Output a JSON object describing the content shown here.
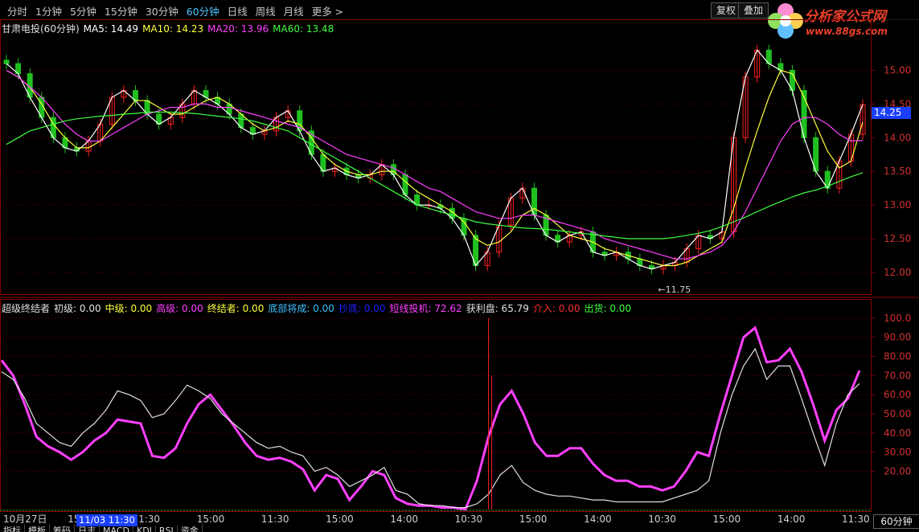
{
  "toolbar": {
    "tabs": [
      "分时",
      "1分钟",
      "5分钟",
      "15分钟",
      "30分钟",
      "60分钟",
      "日线",
      "周线",
      "月线",
      "更多 >"
    ],
    "active_tab": "60分钟",
    "fuquan_label": "复权",
    "overlay_label": "叠加"
  },
  "logo": {
    "name": "分析家公式网",
    "url": "www.88gs.com"
  },
  "stock_line": {
    "name": "甘肃电投(60分钟)",
    "ma5": "MA5: 14.49",
    "ma10": "MA10: 14.23",
    "ma20": "MA20: 13.96",
    "ma60": "MA60: 13.48"
  },
  "indicator_line": {
    "name": "超级终结者",
    "items": [
      {
        "label": "初级: 0.00",
        "color": "#e0e0e0"
      },
      {
        "label": "中级: 0.00",
        "color": "#ffff40"
      },
      {
        "label": "高级: 0.00",
        "color": "#ff40ff"
      },
      {
        "label": "终结者: 0.00",
        "color": "#ffff40"
      },
      {
        "label": "底部将成: 0.00",
        "color": "#40c0ff"
      },
      {
        "label": "抄底: 0.00",
        "color": "#2020ff"
      },
      {
        "label": "短线投机: 72.62",
        "color": "#ff40ff"
      },
      {
        "label": "获利盘: 65.79",
        "color": "#e0e0e0"
      },
      {
        "label": "介入: 0.00",
        "color": "#ff3030"
      },
      {
        "label": "出货: 0.00",
        "color": "#40ff40"
      }
    ]
  },
  "price_tag": "14.25",
  "high_label": "11.75",
  "time_cursor": "11/03 11:30",
  "period_box": "60分钟",
  "bottom_tabs": [
    "指标",
    "模板",
    "筹码",
    "日志",
    "MACD",
    "KDJ",
    "RSI",
    "资金"
  ],
  "chart_data": [
    {
      "type": "candlestick",
      "title": "甘肃电投(60分钟)",
      "ylim": [
        11.7,
        15.4
      ],
      "yticks": [
        "15.00",
        "14.50",
        "14.00",
        "13.50",
        "13.00",
        "12.50",
        "12.00"
      ],
      "ytick_values": [
        15.0,
        14.5,
        14.0,
        13.5,
        13.0,
        12.5,
        12.0
      ],
      "low_annotation": "11.75",
      "colors": {
        "up": "#ff2020",
        "down": "#20c020",
        "ma5": "#ffffff",
        "ma10": "#ffff40",
        "ma20": "#ff40ff",
        "ma60": "#40ff40"
      },
      "series": [
        {
          "name": "MA5",
          "values": [
            15.1,
            14.95,
            14.6,
            14.3,
            14.0,
            13.85,
            13.8,
            13.95,
            14.2,
            14.6,
            14.7,
            14.55,
            14.35,
            14.2,
            14.3,
            14.5,
            14.7,
            14.6,
            14.5,
            14.35,
            14.15,
            14.05,
            14.1,
            14.3,
            14.4,
            14.1,
            13.75,
            13.5,
            13.55,
            13.45,
            13.4,
            13.45,
            13.6,
            13.45,
            13.15,
            13.0,
            13.0,
            12.95,
            12.8,
            12.55,
            12.1,
            12.3,
            12.7,
            13.1,
            13.25,
            12.85,
            12.55,
            12.45,
            12.55,
            12.6,
            12.3,
            12.25,
            12.3,
            12.2,
            12.1,
            12.05,
            12.1,
            12.15,
            12.35,
            12.55,
            12.5,
            12.6,
            14.0,
            14.9,
            15.3,
            15.1,
            15.0,
            14.7,
            14.0,
            13.5,
            13.25,
            13.65,
            14.05,
            14.49
          ]
        },
        {
          "name": "MA10",
          "values": [
            15.0,
            14.9,
            14.75,
            14.5,
            14.2,
            14.0,
            13.85,
            13.85,
            13.95,
            14.15,
            14.35,
            14.55,
            14.55,
            14.45,
            14.35,
            14.35,
            14.45,
            14.55,
            14.6,
            14.5,
            14.35,
            14.2,
            14.1,
            14.15,
            14.25,
            14.2,
            14.0,
            13.75,
            13.6,
            13.5,
            13.45,
            13.45,
            13.5,
            13.5,
            13.35,
            13.2,
            13.1,
            13.0,
            12.9,
            12.75,
            12.5,
            12.4,
            12.45,
            12.6,
            12.85,
            12.95,
            12.85,
            12.7,
            12.55,
            12.5,
            12.45,
            12.35,
            12.3,
            12.25,
            12.2,
            12.15,
            12.1,
            12.1,
            12.15,
            12.25,
            12.35,
            12.45,
            12.95,
            13.55,
            14.1,
            14.6,
            15.0,
            14.95,
            14.6,
            14.2,
            13.8,
            13.55,
            13.65,
            14.23
          ]
        },
        {
          "name": "MA20",
          "values": [
            15.0,
            14.9,
            14.75,
            14.6,
            14.4,
            14.2,
            14.05,
            13.95,
            13.95,
            14.05,
            14.15,
            14.25,
            14.35,
            14.4,
            14.45,
            14.45,
            14.5,
            14.5,
            14.45,
            14.45,
            14.4,
            14.35,
            14.3,
            14.25,
            14.2,
            14.15,
            14.05,
            13.95,
            13.85,
            13.75,
            13.7,
            13.65,
            13.6,
            13.55,
            13.45,
            13.35,
            13.25,
            13.2,
            13.1,
            13.0,
            12.9,
            12.85,
            12.8,
            12.8,
            12.85,
            12.85,
            12.8,
            12.75,
            12.7,
            12.65,
            12.6,
            12.5,
            12.45,
            12.4,
            12.35,
            12.3,
            12.25,
            12.2,
            12.2,
            12.25,
            12.3,
            12.4,
            12.6,
            12.9,
            13.25,
            13.6,
            13.95,
            14.2,
            14.3,
            14.3,
            14.2,
            14.05,
            13.95,
            13.96
          ]
        },
        {
          "name": "MA60",
          "values": [
            13.9,
            14.0,
            14.1,
            14.15,
            14.2,
            14.25,
            14.28,
            14.3,
            14.32,
            14.33,
            14.35,
            14.36,
            14.38,
            14.38,
            14.38,
            14.37,
            14.36,
            14.34,
            14.32,
            14.3,
            14.28,
            14.25,
            14.2,
            14.15,
            14.1,
            14.0,
            13.9,
            13.8,
            13.7,
            13.6,
            13.5,
            13.4,
            13.3,
            13.2,
            13.1,
            13.0,
            12.95,
            12.9,
            12.85,
            12.8,
            12.75,
            12.72,
            12.7,
            12.68,
            12.66,
            12.65,
            12.64,
            12.62,
            12.6,
            12.58,
            12.56,
            12.54,
            12.52,
            12.5,
            12.5,
            12.5,
            12.5,
            12.52,
            12.55,
            12.58,
            12.62,
            12.68,
            12.75,
            12.82,
            12.9,
            12.98,
            13.05,
            13.12,
            13.18,
            13.22,
            13.28,
            13.35,
            13.42,
            13.48
          ]
        }
      ]
    },
    {
      "type": "line",
      "title": "超级终结者",
      "ylim": [
        0,
        105
      ],
      "yticks": [
        "100.0",
        "90.00",
        "80.00",
        "70.00",
        "60.00",
        "50.00",
        "40.00",
        "30.00",
        "20.00"
      ],
      "ytick_values": [
        100,
        90,
        80,
        70,
        60,
        50,
        40,
        30,
        20
      ],
      "series": [
        {
          "name": "短线投机",
          "color": "#ff40ff",
          "values": [
            78,
            70,
            55,
            38,
            33,
            30,
            26,
            30,
            36,
            40,
            47,
            46,
            45,
            28,
            27,
            32,
            45,
            55,
            60,
            52,
            44,
            35,
            28,
            26,
            27,
            25,
            21,
            10,
            18,
            16,
            5,
            12,
            20,
            18,
            6,
            3,
            2,
            2,
            1,
            1,
            0,
            15,
            38,
            55,
            62,
            50,
            35,
            28,
            28,
            32,
            32,
            24,
            18,
            15,
            15,
            12,
            12,
            10,
            12,
            20,
            30,
            28,
            50,
            70,
            90,
            95,
            77,
            78,
            84,
            72,
            55,
            36,
            52,
            58,
            72.6
          ]
        },
        {
          "name": "获利盘",
          "color": "#e0e0e0",
          "values": [
            72,
            68,
            58,
            45,
            40,
            35,
            33,
            40,
            45,
            52,
            62,
            60,
            57,
            48,
            50,
            57,
            65,
            62,
            58,
            50,
            45,
            40,
            35,
            32,
            33,
            30,
            28,
            20,
            22,
            18,
            12,
            15,
            18,
            22,
            10,
            8,
            3,
            2,
            2,
            1,
            1,
            3,
            8,
            18,
            23,
            14,
            10,
            8,
            7,
            7,
            6,
            5,
            5,
            4,
            4,
            4,
            4,
            4,
            6,
            8,
            10,
            15,
            40,
            60,
            75,
            84,
            68,
            75,
            75,
            58,
            40,
            23,
            45,
            60,
            65.8
          ]
        },
        {
          "name": "介入",
          "color": "#ff2020",
          "values": [
            0,
            0,
            0,
            0,
            0,
            0,
            0,
            0,
            0,
            0,
            0,
            0,
            0,
            0,
            0,
            0,
            0,
            0,
            0,
            0,
            0,
            0,
            0,
            0,
            0,
            0,
            0,
            0,
            0,
            0,
            0,
            0,
            0,
            0,
            0,
            0,
            0,
            0,
            0,
            0,
            0,
            0,
            100,
            0,
            0,
            0,
            0,
            0,
            0,
            0,
            0,
            0,
            0,
            0,
            0,
            0,
            0,
            0,
            0,
            0,
            0,
            0,
            0,
            0,
            0,
            0,
            0,
            0,
            0,
            0,
            0,
            0,
            0,
            0,
            0
          ]
        }
      ]
    }
  ],
  "x_axis_labels": [
    "10月27日",
    "15:00",
    "11:30",
    "15:00",
    "11:30",
    "15:00",
    "14:00",
    "10:30",
    "15:00",
    "14:00",
    "10:30",
    "15:00",
    "14:00",
    "11:30"
  ]
}
